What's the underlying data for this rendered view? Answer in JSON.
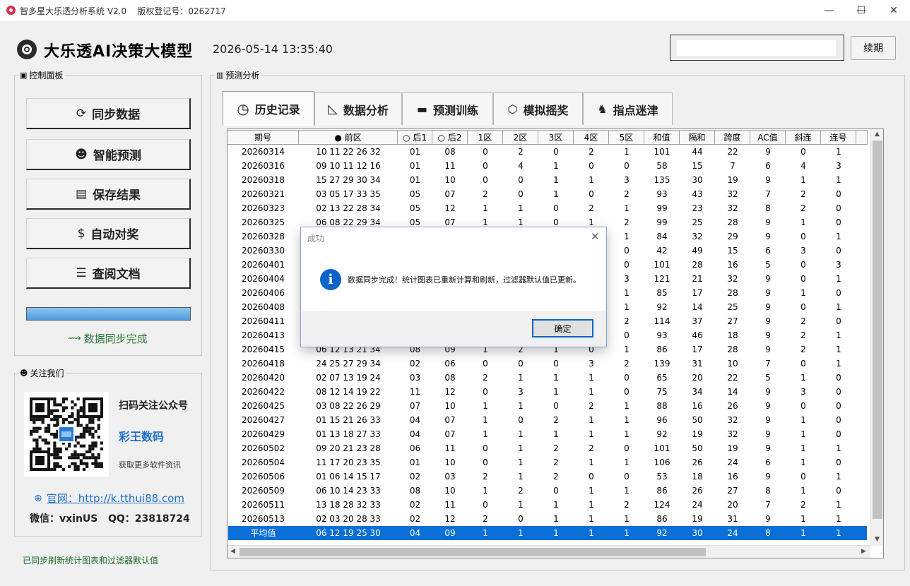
{
  "window": {
    "title": "智多星大乐透分析系统 V2.0    版权登记号：0262717",
    "minimize": "—",
    "maximize": "☐",
    "close": "✕"
  },
  "header": {
    "app_title": "大乐透AI决策大模型",
    "datetime": "2026-05-14 13:35:40",
    "license_value": "",
    "renew_label": "续期"
  },
  "control_panel": {
    "label": "控制面板",
    "buttons": [
      {
        "label": "同步数据",
        "icon": "⟳"
      },
      {
        "label": "智能预测",
        "icon": "☻"
      },
      {
        "label": "保存结果",
        "icon": "▤"
      },
      {
        "label": "自动对奖",
        "icon": "$"
      },
      {
        "label": "查阅文档",
        "icon": "☰"
      }
    ],
    "progress": 1.0,
    "status": "数据同步完成"
  },
  "follow": {
    "label": "关注我们",
    "scan_text": "扫码关注公众号",
    "account": "彩王数码",
    "more_info": "获取更多软件资讯",
    "website": "官网：http://k.tthui88.com",
    "contact": "微信：vxinUS   QQ：23818724"
  },
  "bottom_status": "已同步刷新统计图表和过滤器默认值",
  "analysis": {
    "label": "预测分析",
    "tabs": [
      {
        "label": "历史记录",
        "icon": "◷"
      },
      {
        "label": "数据分析",
        "icon": "◺"
      },
      {
        "label": "预测训练",
        "icon": "▬"
      },
      {
        "label": "模拟摇奖",
        "icon": "⬡"
      },
      {
        "label": "指点迷津",
        "icon": "♞"
      }
    ]
  },
  "table": {
    "columns": [
      "期号",
      "● 前区",
      "○ 后1",
      "○ 后2",
      "1区",
      "2区",
      "3区",
      "4区",
      "5区",
      "和值",
      "隔和",
      "跨度",
      "AC值",
      "斜连",
      "连号"
    ],
    "rows": [
      [
        "20260314",
        "10 11 22 26 32",
        "01",
        "08",
        "0",
        "2",
        "0",
        "2",
        "1",
        "101",
        "44",
        "22",
        "9",
        "0",
        "1"
      ],
      [
        "20260316",
        "09 10 11 12 16",
        "01",
        "11",
        "0",
        "4",
        "1",
        "0",
        "0",
        "58",
        "15",
        "7",
        "6",
        "4",
        "3"
      ],
      [
        "20260318",
        "15 27 29 30 34",
        "01",
        "10",
        "0",
        "0",
        "1",
        "1",
        "3",
        "135",
        "30",
        "19",
        "9",
        "1",
        "1"
      ],
      [
        "20260321",
        "03 05 17 33 35",
        "05",
        "07",
        "2",
        "0",
        "1",
        "0",
        "2",
        "93",
        "43",
        "32",
        "7",
        "2",
        "0"
      ],
      [
        "20260323",
        "02 13 22 28 34",
        "05",
        "12",
        "1",
        "1",
        "0",
        "2",
        "1",
        "99",
        "23",
        "32",
        "8",
        "2",
        "0"
      ],
      [
        "20260325",
        "06 08 22 29 34",
        "05",
        "07",
        "1",
        "1",
        "0",
        "1",
        "2",
        "99",
        "25",
        "28",
        "9",
        "1",
        "0"
      ],
      [
        "20260328",
        "",
        "",
        "",
        "",
        "",
        "",
        "",
        "1",
        "84",
        "32",
        "29",
        "9",
        "0",
        "1"
      ],
      [
        "20260330",
        "",
        "",
        "",
        "",
        "",
        "",
        "",
        "0",
        "42",
        "49",
        "15",
        "6",
        "3",
        "0"
      ],
      [
        "20260401",
        "",
        "",
        "",
        "",
        "",
        "",
        "",
        "0",
        "101",
        "28",
        "16",
        "5",
        "0",
        "3"
      ],
      [
        "20260404",
        "",
        "",
        "",
        "",
        "",
        "",
        "",
        "3",
        "121",
        "21",
        "32",
        "9",
        "0",
        "1"
      ],
      [
        "20260406",
        "",
        "",
        "",
        "",
        "",
        "",
        "",
        "1",
        "85",
        "17",
        "28",
        "9",
        "1",
        "0"
      ],
      [
        "20260408",
        "",
        "",
        "",
        "",
        "",
        "",
        "",
        "1",
        "92",
        "14",
        "25",
        "9",
        "0",
        "1"
      ],
      [
        "20260411",
        "",
        "",
        "",
        "",
        "",
        "",
        "",
        "2",
        "114",
        "37",
        "27",
        "9",
        "2",
        "0"
      ],
      [
        "20260413",
        "",
        "",
        "",
        "",
        "",
        "",
        "",
        "0",
        "93",
        "46",
        "18",
        "9",
        "2",
        "1"
      ],
      [
        "20260415",
        "06 12 13 21 34",
        "08",
        "09",
        "1",
        "2",
        "1",
        "0",
        "1",
        "86",
        "17",
        "28",
        "9",
        "2",
        "1"
      ],
      [
        "20260418",
        "24 25 27 29 34",
        "02",
        "06",
        "0",
        "0",
        "0",
        "3",
        "2",
        "139",
        "31",
        "10",
        "7",
        "0",
        "1"
      ],
      [
        "20260420",
        "02 07 13 19 24",
        "03",
        "08",
        "2",
        "1",
        "1",
        "1",
        "0",
        "65",
        "20",
        "22",
        "5",
        "1",
        "0"
      ],
      [
        "20260422",
        "08 12 14 19 22",
        "11",
        "12",
        "0",
        "3",
        "1",
        "1",
        "0",
        "75",
        "34",
        "14",
        "9",
        "3",
        "0"
      ],
      [
        "20260425",
        "03 08 22 26 29",
        "07",
        "10",
        "1",
        "1",
        "0",
        "2",
        "1",
        "88",
        "16",
        "26",
        "9",
        "0",
        "0"
      ],
      [
        "20260427",
        "01 15 21 26 33",
        "04",
        "07",
        "1",
        "0",
        "2",
        "1",
        "1",
        "96",
        "50",
        "32",
        "9",
        "1",
        "0"
      ],
      [
        "20260429",
        "01 13 18 27 33",
        "04",
        "07",
        "1",
        "1",
        "1",
        "1",
        "1",
        "92",
        "19",
        "32",
        "9",
        "1",
        "0"
      ],
      [
        "20260502",
        "09 20 21 23 28",
        "06",
        "11",
        "0",
        "1",
        "2",
        "2",
        "0",
        "101",
        "50",
        "19",
        "9",
        "1",
        "1"
      ],
      [
        "20260504",
        "11 17 20 23 35",
        "01",
        "10",
        "0",
        "1",
        "2",
        "1",
        "1",
        "106",
        "26",
        "24",
        "6",
        "1",
        "0"
      ],
      [
        "20260506",
        "01 06 14 15 17",
        "02",
        "03",
        "2",
        "1",
        "2",
        "0",
        "0",
        "53",
        "18",
        "16",
        "9",
        "0",
        "1"
      ],
      [
        "20260509",
        "06 10 14 23 33",
        "08",
        "10",
        "1",
        "2",
        "0",
        "1",
        "1",
        "86",
        "26",
        "27",
        "8",
        "1",
        "0"
      ],
      [
        "20260511",
        "13 18 28 32 33",
        "02",
        "11",
        "0",
        "1",
        "1",
        "1",
        "2",
        "124",
        "24",
        "20",
        "7",
        "2",
        "1"
      ],
      [
        "20260513",
        "02 03 20 28 33",
        "02",
        "12",
        "2",
        "0",
        "1",
        "1",
        "1",
        "86",
        "19",
        "31",
        "9",
        "1",
        "1"
      ]
    ],
    "average": [
      "平均值",
      "06 12 19 25 30",
      "04",
      "09",
      "1",
      "1",
      "1",
      "1",
      "1",
      "92",
      "30",
      "24",
      "8",
      "1",
      "1"
    ]
  },
  "dialog": {
    "title": "成功",
    "message": "数据同步完成！统计图表已重新计算和刷新，过滤器默认值已更新。",
    "ok_label": "确定",
    "close": "✕",
    "info_icon": "i"
  },
  "colors": {
    "selection": "#0a6fd6",
    "status_green": "#2d7a3a",
    "link_blue": "#1f6fd0"
  }
}
